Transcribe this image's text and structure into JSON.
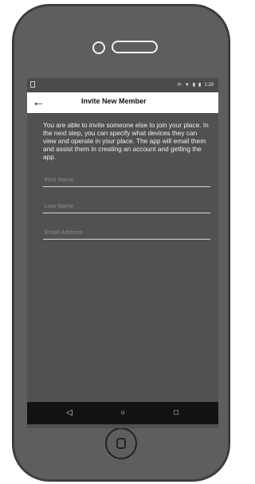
{
  "status_bar": {
    "time": "1:28",
    "icons": [
      "sync-icon",
      "wifi-icon",
      "signal-icon",
      "battery-icon"
    ]
  },
  "app_bar": {
    "back_icon": "arrow-left-icon",
    "title": "Invite New Member"
  },
  "content": {
    "intro": "You are able to invite someone else to join your place. In the next step, you can specify what devices they can view and operate in your place. The app will email them and assist them in creating an account and getting the app.",
    "fields": [
      {
        "placeholder": "First Name",
        "value": ""
      },
      {
        "placeholder": "Last Name",
        "value": ""
      },
      {
        "placeholder": "Email Address",
        "value": ""
      }
    ]
  },
  "nav_bar": {
    "icons": [
      "back-triangle-icon",
      "home-circle-icon",
      "recents-square-icon"
    ]
  }
}
